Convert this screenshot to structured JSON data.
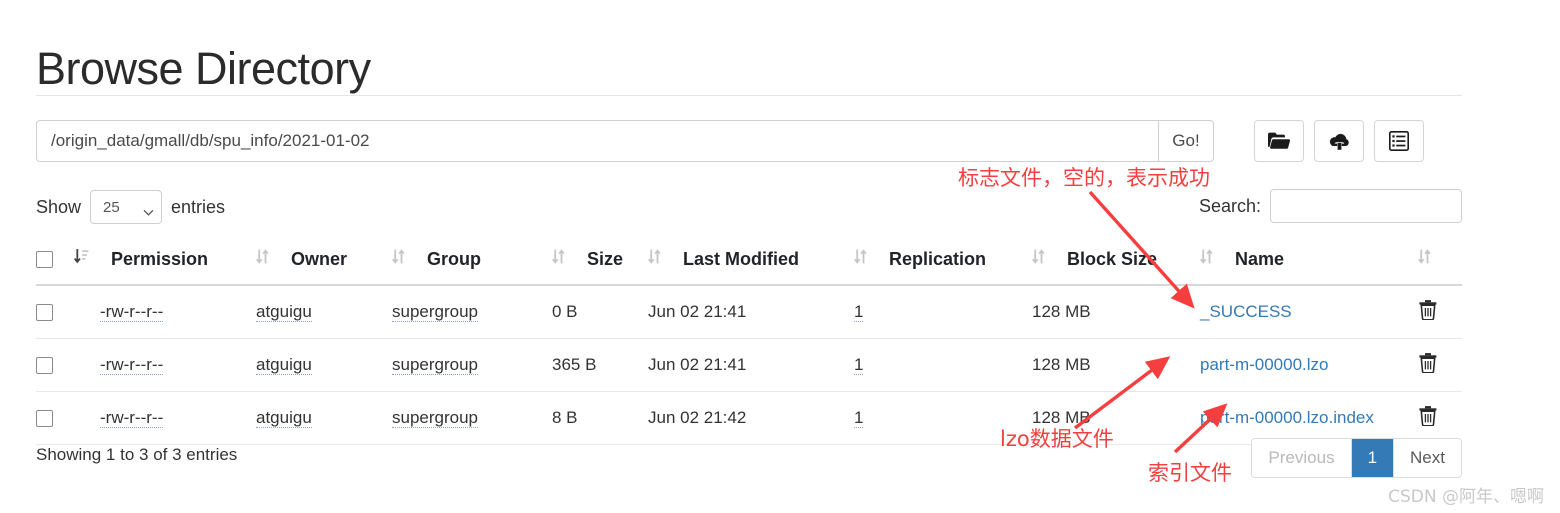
{
  "page": {
    "title": "Browse Directory",
    "watermark": "CSDN @阿年、嗯啊"
  },
  "pathbar": {
    "value": "/origin_data/gmall/db/spu_info/2021-01-02",
    "placeholder": "",
    "go_label": "Go!",
    "buttons": [
      {
        "name": "new-directory-button",
        "icon": "folder-open-icon"
      },
      {
        "name": "upload-files-button",
        "icon": "cloud-upload-icon"
      },
      {
        "name": "cut-high-availability-button",
        "icon": "list-alt-icon"
      }
    ]
  },
  "controls": {
    "show_label": "Show",
    "entries_label": "entries",
    "entries_value": "25",
    "entries_options": [
      "25"
    ],
    "search_label": "Search:",
    "search_value": "",
    "search_placeholder": ""
  },
  "table": {
    "columns": [
      {
        "key": "check",
        "label": ""
      },
      {
        "key": "permission",
        "label": "Permission"
      },
      {
        "key": "owner",
        "label": "Owner"
      },
      {
        "key": "group",
        "label": "Group"
      },
      {
        "key": "size",
        "label": "Size"
      },
      {
        "key": "modified",
        "label": "Last Modified"
      },
      {
        "key": "replication",
        "label": "Replication"
      },
      {
        "key": "blocksize",
        "label": "Block Size"
      },
      {
        "key": "name",
        "label": "Name"
      },
      {
        "key": "actions",
        "label": ""
      }
    ],
    "rows": [
      {
        "permission": "-rw-r--r--",
        "owner": "atguigu",
        "group": "supergroup",
        "size": "0 B",
        "modified": "Jun 02 21:41",
        "replication": "1",
        "blocksize": "128 MB",
        "name": "_SUCCESS"
      },
      {
        "permission": "-rw-r--r--",
        "owner": "atguigu",
        "group": "supergroup",
        "size": "365 B",
        "modified": "Jun 02 21:41",
        "replication": "1",
        "blocksize": "128 MB",
        "name": "part-m-00000.lzo"
      },
      {
        "permission": "-rw-r--r--",
        "owner": "atguigu",
        "group": "supergroup",
        "size": "8 B",
        "modified": "Jun 02 21:42",
        "replication": "1",
        "blocksize": "128 MB",
        "name": "part-m-00000.lzo.index"
      }
    ]
  },
  "footer": {
    "showing": "Showing 1 to 3 of 3 entries",
    "pagination": {
      "previous": "Previous",
      "pages": [
        "1"
      ],
      "next": "Next",
      "active": "1"
    }
  },
  "annotations": [
    {
      "text": "标志文件，空的，表示成功",
      "target": "_SUCCESS"
    },
    {
      "text": "lzo数据文件",
      "target": "part-m-00000.lzo"
    },
    {
      "text": "索引文件",
      "target": "part-m-00000.lzo.index"
    }
  ],
  "colors": {
    "link": "#337ab7",
    "active_page": "#337ab7",
    "annotation": "#f53f3f",
    "watermark": "#c9c9c9"
  }
}
